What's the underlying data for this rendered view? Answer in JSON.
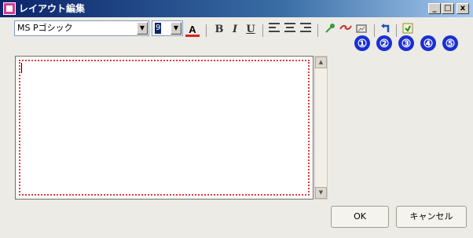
{
  "window": {
    "title": "レイアウト編集"
  },
  "title_buttons": {
    "minimize": "_",
    "maximize": "□",
    "close": "x"
  },
  "toolbar": {
    "font_name": "MS Pゴシック",
    "font_size": "9",
    "bold": "B",
    "italic": "I",
    "underline": "U",
    "font_color_label": "A"
  },
  "badges": [
    "①",
    "②",
    "③",
    "④",
    "⑤"
  ],
  "buttons": {
    "ok": "OK",
    "cancel": "キャンセル"
  },
  "colors": {
    "badge": "#1a2fd0",
    "editor_dotted_border": "#e63a3a",
    "titlebar": "#0a246a"
  }
}
